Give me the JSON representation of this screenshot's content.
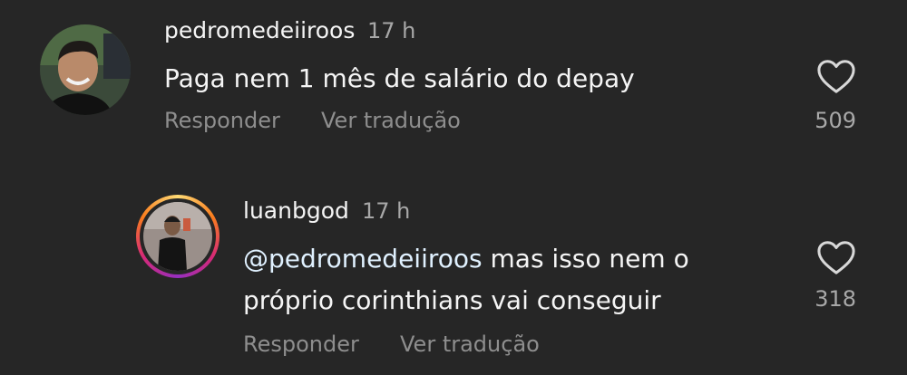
{
  "comments": [
    {
      "username": "pedromedeiiroos",
      "time": "17 h",
      "text": "Paga nem 1 mês de salário do depay",
      "reply_label": "Responder",
      "translate_label": "Ver tradução",
      "likes": "509",
      "avatar_icon": "profile-photo-man-smiling",
      "has_story_ring": false
    },
    {
      "username": "luanbgod",
      "time": "17 h",
      "mention": "@pedromedeiiroos",
      "text_line1": " mas isso nem o",
      "text_line2": "próprio corinthians vai conseguir",
      "reply_label": "Responder",
      "translate_label": "Ver tradução",
      "likes": "318",
      "avatar_icon": "profile-photo-mirror-selfie",
      "has_story_ring": true
    }
  ],
  "colors": {
    "background": "#262626",
    "primary_text": "#f5f5f5",
    "secondary_text": "#a8a8a8",
    "mention": "#e0f1ff"
  }
}
